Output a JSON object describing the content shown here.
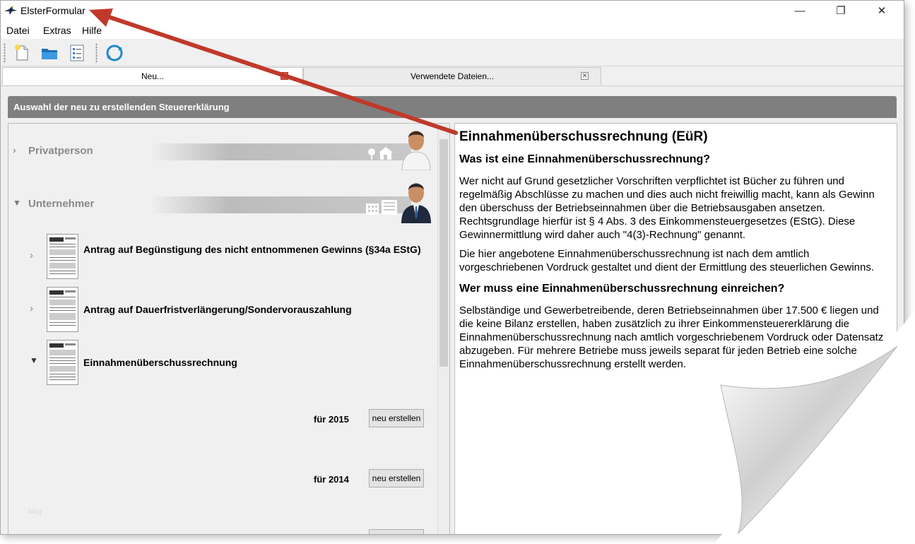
{
  "window": {
    "title": "ElsterFormular",
    "controls": {
      "minimize": "—",
      "restore": "❐",
      "close": "✕"
    }
  },
  "menu": [
    "Datei",
    "Extras",
    "Hilfe"
  ],
  "toolbar": {
    "icons": [
      "new-file-icon",
      "open-folder-icon",
      "checklist-icon",
      "refresh-icon"
    ]
  },
  "tabs": [
    {
      "label": "Neu...",
      "active": true
    },
    {
      "label": "Verwendete Dateien...",
      "active": false
    }
  ],
  "section_header": "Auswahl der neu zu erstellenden Steuererklärung",
  "categories": [
    {
      "label": "Privatperson",
      "expanded": false
    },
    {
      "label": "Unternehmer",
      "expanded": true
    }
  ],
  "forms": [
    {
      "label": "Antrag auf Begünstigung des nicht entnommenen Gewinns (§34a EStG)",
      "expanded": false
    },
    {
      "label": "Antrag auf Dauerfristverlängerung/Sondervorauszahlung",
      "expanded": false
    },
    {
      "label": "Einnahmenüberschussrechnung",
      "expanded": true
    }
  ],
  "years": [
    {
      "label": "für 2015",
      "button": "neu erstellen"
    },
    {
      "label": "für 2014",
      "button": "neu erstellen"
    }
  ],
  "watermark": "blog",
  "detail": {
    "title": "Einnahmenüberschussrechnung (EüR)",
    "heading1": "Was ist eine Einnahmenüberschussrechnung?",
    "para1": "Wer nicht auf Grund gesetzlicher Vorschriften verpflichtet ist Bücher zu führen und regelmäßig Abschlüsse zu machen und dies auch nicht freiwillig macht, kann als Gewinn den überschuss der Betriebseinnahmen über die Betriebsausgaben ansetzen. Rechtsgrundlage hierfür ist § 4 Abs. 3 des Einkommensteuergesetzes (EStG). Diese Gewinnermittlung wird daher auch \"4(3)-Rechnung\" genannt.",
    "para2": "Die hier angebotene Einnahmenüberschussrechnung ist nach dem amtlich vorgeschriebenen Vordruck gestaltet und dient der Ermittlung des steuerlichen Gewinns.",
    "heading2": "Wer muss eine Einnahmenüberschussrechnung einreichen?",
    "para3": "Selbständige und Gewerbetreibende, deren Betriebseinnahmen über 17.500 € liegen und die keine Bilanz erstellen, haben zusätzlich zu ihrer Einkommensteuererklärung die Einnahmenüberschussrechnung nach amtlich vorgeschriebenem Vordruck oder Datensatz abzugeben. Für mehrere Betriebe muss jeweils separat für jeden Betrieb eine solche Einnahmenüberschussrechnung erstellt werden."
  },
  "colors": {
    "header_bg": "#7f7f7f",
    "arrow": "#c0392b",
    "active_tab_close": "#e1533b"
  }
}
